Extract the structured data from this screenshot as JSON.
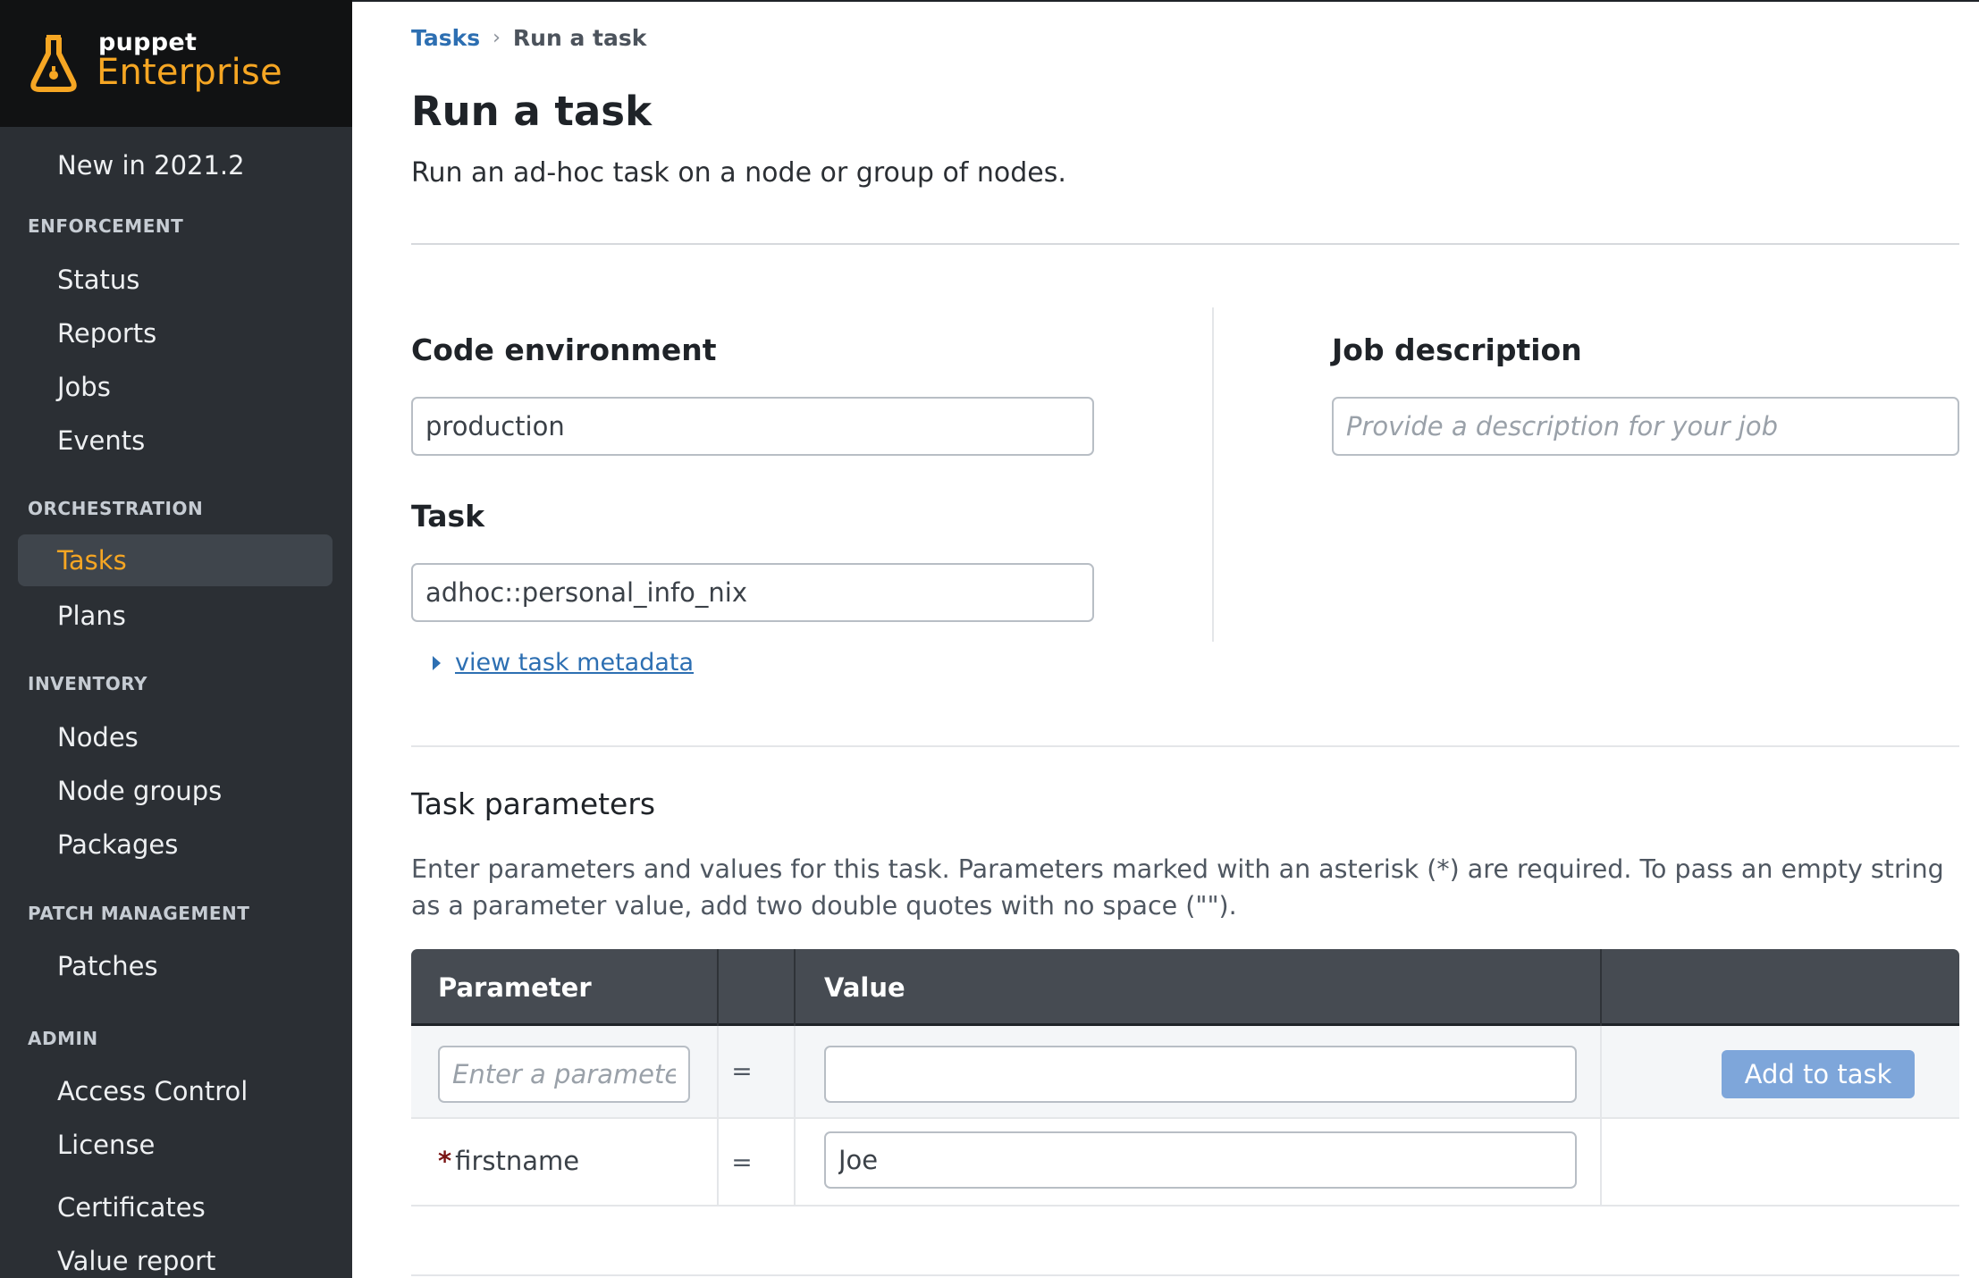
{
  "brand": {
    "small": "puppet",
    "big": "Enterprise"
  },
  "sidebar": {
    "new_item": "New in 2021.2",
    "sections": [
      {
        "label": "ENFORCEMENT",
        "items": [
          "Status",
          "Reports",
          "Jobs",
          "Events"
        ]
      },
      {
        "label": "ORCHESTRATION",
        "items": [
          "Tasks",
          "Plans"
        ]
      },
      {
        "label": "INVENTORY",
        "items": [
          "Nodes",
          "Node groups",
          "Packages"
        ]
      },
      {
        "label": "PATCH MANAGEMENT",
        "items": [
          "Patches"
        ]
      },
      {
        "label": "ADMIN",
        "items": [
          "Access Control",
          "License",
          "Certificates",
          "Value report"
        ]
      }
    ],
    "active_item": "Tasks"
  },
  "breadcrumb": {
    "parent": "Tasks",
    "separator": "›",
    "current": "Run a task"
  },
  "page": {
    "title": "Run a task",
    "subtitle": "Run an ad-hoc task on a node or group of nodes."
  },
  "form": {
    "code_environment_label": "Code environment",
    "code_environment_value": "production",
    "task_label": "Task",
    "task_value": "adhoc::personal_info_nix",
    "metadata_link": "view task metadata",
    "job_description_label": "Job description",
    "job_description_placeholder": "Provide a description for your job"
  },
  "params": {
    "title": "Task parameters",
    "description": "Enter parameters and values for this task. Parameters marked with an asterisk (*) are required. To pass an empty string as a parameter value, add two double quotes with no space (\"\").",
    "headers": {
      "parameter": "Parameter",
      "value": "Value"
    },
    "new_param_placeholder": "Enter a paramete...",
    "equals": "=",
    "add_button": "Add to task",
    "rows": [
      {
        "required": true,
        "required_mark": "*",
        "name": "firstname",
        "value": "Joe"
      }
    ]
  },
  "colors": {
    "accent": "#f6a623",
    "link": "#2d6fb2",
    "sidebar_bg": "#2b2f34",
    "button": "#7ea6da"
  }
}
